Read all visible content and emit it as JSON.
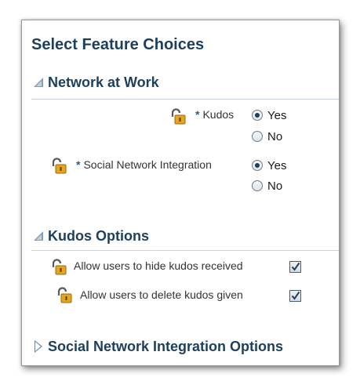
{
  "page": {
    "title": "Select Feature Choices"
  },
  "sections": {
    "network_at_work": {
      "title": "Network at Work",
      "expanded": true,
      "fields": {
        "kudos": {
          "required_marker": "*",
          "label": "Kudos",
          "options": [
            "Yes",
            "No"
          ],
          "selected": "Yes"
        },
        "social_network_integration": {
          "required_marker": "*",
          "label": "Social Network Integration",
          "options": [
            "Yes",
            "No"
          ],
          "selected": "Yes"
        }
      }
    },
    "kudos_options": {
      "title": "Kudos Options",
      "expanded": true,
      "fields": {
        "hide_kudos": {
          "label": "Allow users to hide kudos received",
          "checked": true
        },
        "delete_kudos": {
          "label": "Allow users to delete kudos given",
          "checked": true
        }
      }
    },
    "social_network_integration_options": {
      "title": "Social Network Integration Options",
      "expanded": false
    }
  },
  "icons": {
    "lock": "unlocked-padlock-icon",
    "expanded": "disclosure-expanded-icon",
    "collapsed": "disclosure-collapsed-icon"
  },
  "colors": {
    "heading": "#1d3f5e",
    "required": "#2b5d92",
    "lock_body": "#e7a51c",
    "rule": "#c8d3de"
  }
}
